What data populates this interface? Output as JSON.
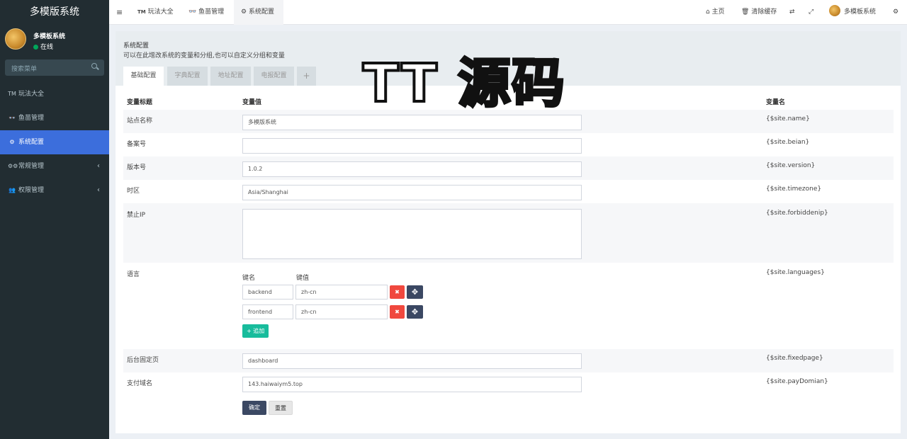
{
  "app": {
    "title": "多模版系统"
  },
  "user": {
    "name": "多模板系统",
    "status": "在线"
  },
  "sidebar": {
    "search_placeholder": "搜索菜单",
    "items": [
      {
        "icon": "TM",
        "label": "玩法大全"
      },
      {
        "icon": "👓",
        "label": "鱼苗管理"
      },
      {
        "icon": "⚙",
        "label": "系统配置"
      },
      {
        "icon": "⚙⚙",
        "label": "常规管理"
      },
      {
        "icon": "👥",
        "label": "权限管理"
      }
    ]
  },
  "topbar": {
    "tabs": [
      {
        "icon": "TM",
        "label": "玩法大全"
      },
      {
        "icon": "👓",
        "label": "鱼苗管理"
      },
      {
        "icon": "⚙",
        "label": "系统配置"
      }
    ],
    "home": "主页",
    "clear_cache": "清除缓存",
    "user_name": "多模板系统"
  },
  "panel": {
    "title": "系统配置",
    "description": "可以在此增改系统的变量和分组,也可以自定义分组和变量",
    "tabs": [
      "基础配置",
      "字典配置",
      "地址配置",
      "电报配置",
      "+"
    ],
    "headers": {
      "title": "变量标题",
      "value": "变量值",
      "name": "变量名"
    },
    "rows": [
      {
        "label": "站点名称",
        "value": "多模版系统",
        "var": "{$site.name}"
      },
      {
        "label": "备案号",
        "value": "",
        "var": "{$site.beian}"
      },
      {
        "label": "版本号",
        "value": "1.0.2",
        "var": "{$site.version}"
      },
      {
        "label": "时区",
        "value": "Asia/Shanghai",
        "var": "{$site.timezone}"
      },
      {
        "label": "禁止IP",
        "value": "",
        "var": "{$site.forbiddenip}"
      },
      {
        "label": "语言",
        "var": "{$site.languages}"
      },
      {
        "label": "后台固定页",
        "value": "dashboard",
        "var": "{$site.fixedpage}"
      },
      {
        "label": "支付域名",
        "value": "143.haiwaiym5.top",
        "var": "{$site.payDomian}"
      }
    ],
    "languages": {
      "key_header": "键名",
      "value_header": "键值",
      "pairs": [
        {
          "key": "backend",
          "value": "zh-cn"
        },
        {
          "key": "frontend",
          "value": "zh-cn"
        }
      ],
      "add_label": "+ 追加"
    },
    "buttons": {
      "ok": "确定",
      "reset": "重置"
    }
  },
  "watermark": "TT 源码",
  "colors": {
    "sidebar_bg": "#222d32",
    "active": "#3c6edc",
    "danger": "#f0483e",
    "primary": "#3b4863",
    "success": "#18bc9c"
  }
}
